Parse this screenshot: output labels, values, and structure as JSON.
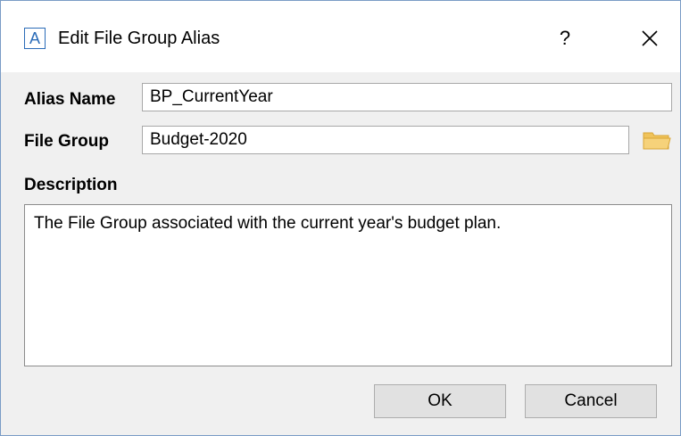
{
  "window": {
    "app_icon_letter": "A",
    "title": "Edit File Group Alias",
    "help_label": "?",
    "close_icon": "close-icon"
  },
  "form": {
    "alias_name_label": "Alias Name",
    "alias_name_value": "BP_CurrentYear",
    "file_group_label": "File Group",
    "file_group_value": "Budget-2020",
    "browse_icon": "folder-icon",
    "description_label": "Description",
    "description_value": "The File Group associated with the current year's budget plan."
  },
  "buttons": {
    "ok": "OK",
    "cancel": "Cancel"
  },
  "colors": {
    "accent": "#2b6cb8",
    "folder": "#f0c35a"
  }
}
